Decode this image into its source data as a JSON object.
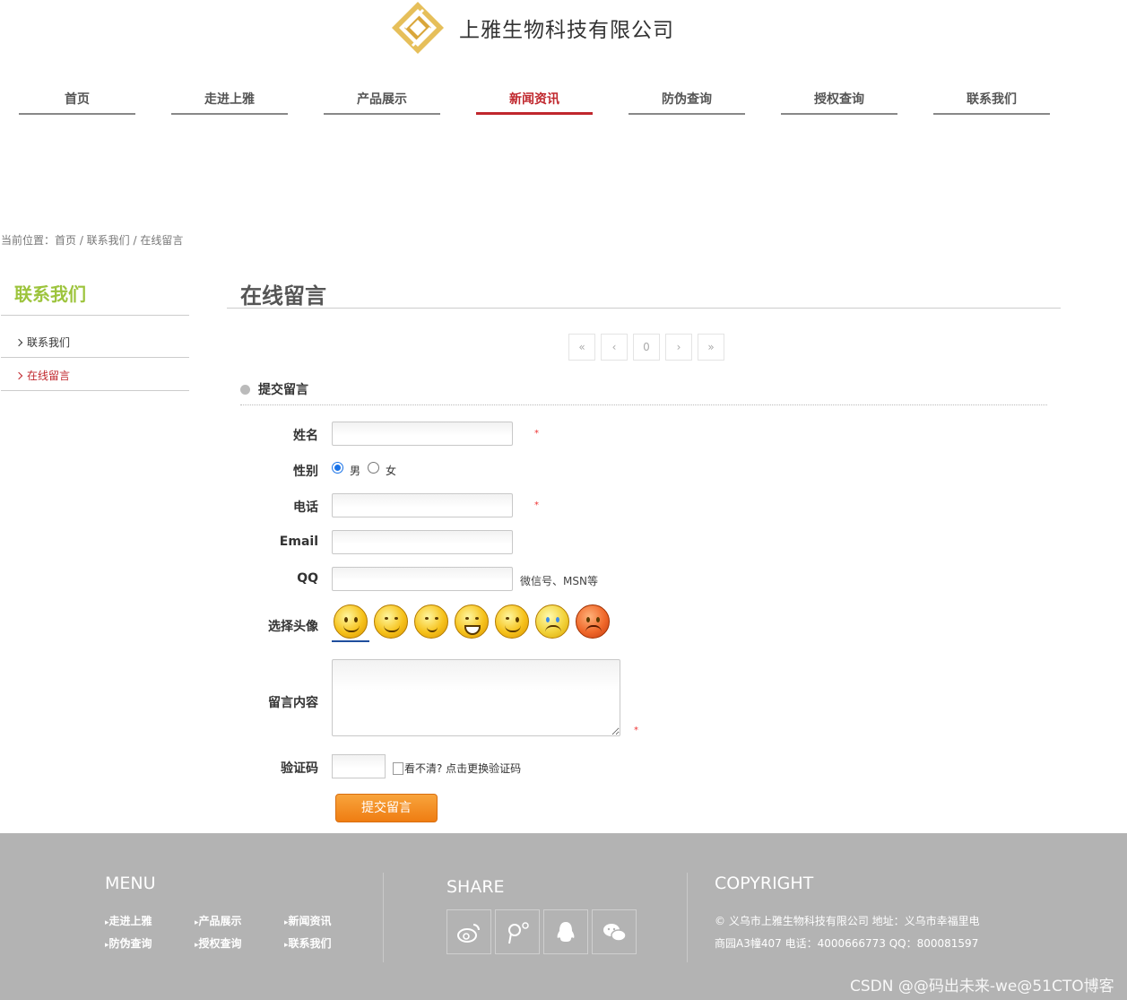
{
  "header": {
    "company_name": "上雅生物科技有限公司"
  },
  "nav": {
    "items": [
      {
        "label": "首页"
      },
      {
        "label": "走进上雅"
      },
      {
        "label": "产品展示"
      },
      {
        "label": "新闻资讯"
      },
      {
        "label": "防伪查询"
      },
      {
        "label": "授权查询"
      },
      {
        "label": "联系我们"
      }
    ],
    "active": "新闻资讯"
  },
  "breadcrumb": {
    "text": "当前位置：首页 / 联系我们 / 在线留言"
  },
  "sidebar": {
    "title": "联系我们",
    "items": [
      {
        "label": "联系我们"
      },
      {
        "label": "在线留言"
      }
    ],
    "active": "在线留言"
  },
  "main": {
    "title": "在线留言",
    "pager": {
      "first": "«",
      "prev": "‹",
      "page": "0",
      "next": "›",
      "last": "»"
    },
    "section_title": "提交留言"
  },
  "form": {
    "name_label": "姓名",
    "name_value": "",
    "gender_label": "性别",
    "gender_male": "男",
    "gender_female": "女",
    "gender_selected": "男",
    "phone_label": "电话",
    "phone_value": "",
    "email_label": "Email",
    "email_value": "",
    "qq_label": "QQ",
    "qq_value": "",
    "qq_hint": "微信号、MSN等",
    "avatar_label": "选择头像",
    "avatar_icons": [
      "smile-face-icon",
      "grin-face-icon",
      "thumbs-up-face-icon",
      "laugh-face-icon",
      "wink-face-icon",
      "cry-face-icon",
      "angry-face-icon"
    ],
    "avatar_selected_index": 0,
    "message_label": "留言内容",
    "message_value": "",
    "captcha_label": "验证码",
    "captcha_value": "",
    "captcha_alt": "看不清? 点击更换验证码",
    "required_mark": "*",
    "submit_label": "提交留言"
  },
  "footer": {
    "menu_title": "MENU",
    "menu_links": [
      "走进上雅",
      "产品展示",
      "新闻资讯",
      "防伪查询",
      "授权查询",
      "联系我们"
    ],
    "share_title": "SHARE",
    "share_icons": [
      "weibo-icon",
      "tencent-weibo-icon",
      "qq-icon",
      "wechat-icon"
    ],
    "copyright_title": "COPYRIGHT",
    "copyright_line1": "© 义乌市上雅生物科技有限公司 地址：义乌市幸福里电",
    "copyright_line2": "商园A3幢407 电话：4000666773 QQ：800081597",
    "watermark": "CSDN @@码出未来-we@51CTO博客"
  },
  "colors": {
    "accent_red": "#c0272d",
    "sidebar_green": "#9dc43d",
    "submit_orange": "#ef7d12",
    "footer_bg": "#b3b3b3"
  }
}
